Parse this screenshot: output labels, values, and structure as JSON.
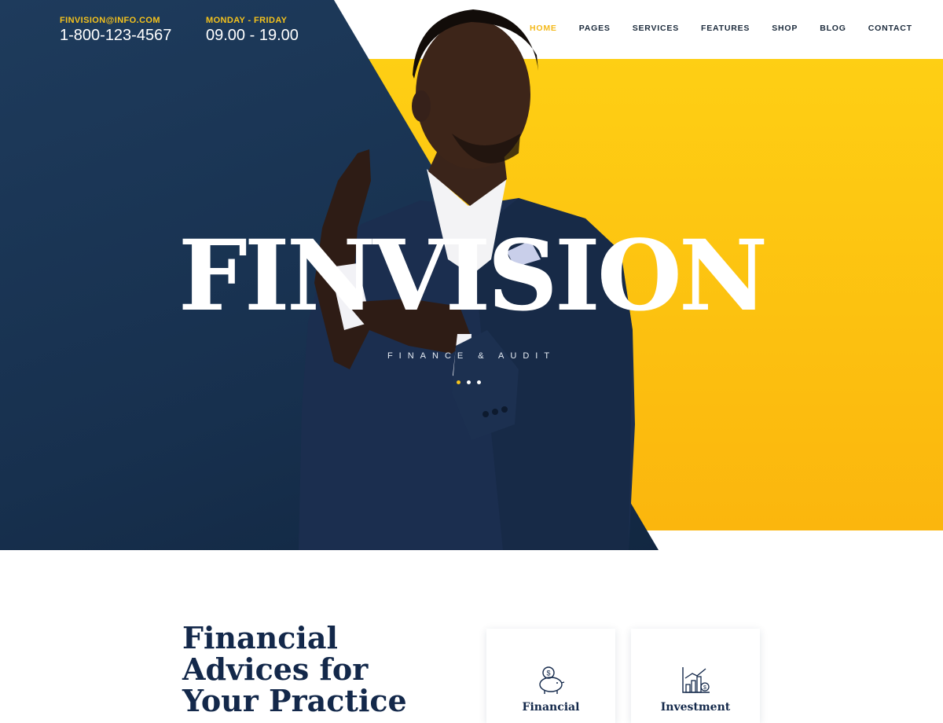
{
  "header": {
    "email_label": "FINVISION@INFO.COM",
    "phone": "1-800-123-4567",
    "hours_label": "MONDAY - FRIDAY",
    "hours": "09.00 - 19.00"
  },
  "nav": {
    "items": [
      {
        "label": "HOME",
        "active": true
      },
      {
        "label": "PAGES"
      },
      {
        "label": "SERVICES"
      },
      {
        "label": "FEATURES"
      },
      {
        "label": "SHOP"
      },
      {
        "label": "BLOG"
      },
      {
        "label": "CONTACT"
      }
    ]
  },
  "hero": {
    "brand": "FINVISION",
    "tagline": "FINANCE & AUDIT",
    "slides": 3,
    "active_slide": 1,
    "colors": {
      "navy": "#1e3b5c",
      "yellow": "#fecf14",
      "accent": "#f4c21c"
    }
  },
  "section": {
    "heading_lines": [
      "Financial",
      "Advices for",
      "Your Practice"
    ],
    "cards": [
      {
        "title": "Financial",
        "icon": "piggy-bank-icon"
      },
      {
        "title": "Investment",
        "icon": "growth-chart-icon"
      }
    ]
  }
}
